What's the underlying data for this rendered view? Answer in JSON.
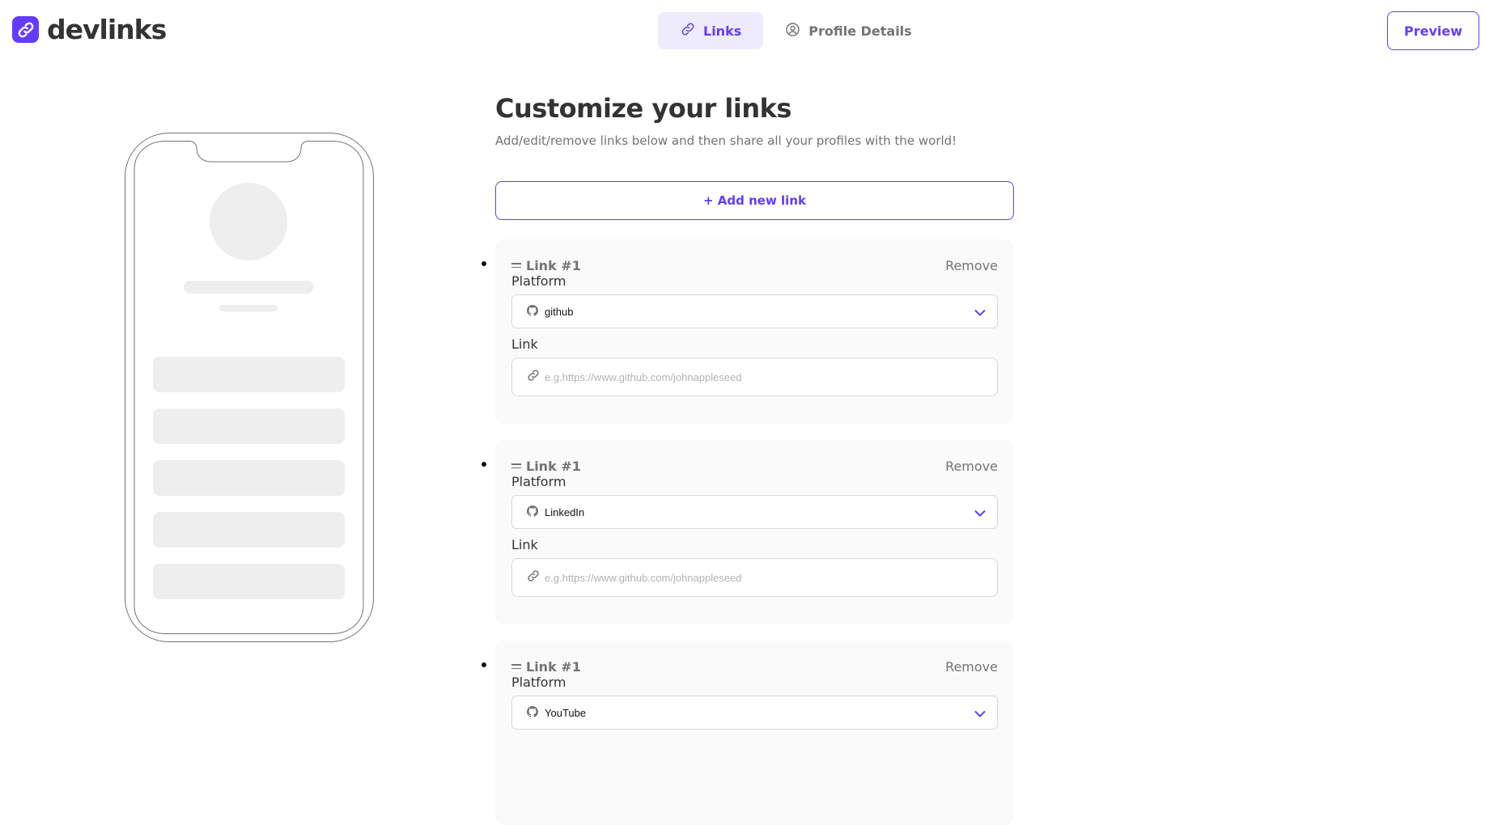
{
  "app": {
    "name": "devlinks",
    "brand_color": "#633cff",
    "logo_icon": "link-logo-icon"
  },
  "nav": {
    "tabs": [
      {
        "label": "Links",
        "icon": "link-icon",
        "active": true
      },
      {
        "label": "Profile Details",
        "icon": "user-circle-icon",
        "active": false
      }
    ],
    "preview_label": "Preview"
  },
  "main": {
    "title": "Customize your links",
    "subtitle": "Add/edit/remove links below and then share all your profiles with the world!",
    "add_label": "+ Add new link",
    "links": [
      {
        "title": "Link #1",
        "remove_label": "Remove",
        "platform_label": "Platform",
        "platform_value": "github",
        "link_label": "Link",
        "link_placeholder": "e.g.https://www.github.com/johnappleseed"
      },
      {
        "title": "Link #1",
        "remove_label": "Remove",
        "platform_label": "Platform",
        "platform_value": "LinkedIn",
        "link_label": "Link",
        "link_placeholder": "e.g.https://www.github.com/johnappleseed"
      },
      {
        "title": "Link #1",
        "remove_label": "Remove",
        "platform_label": "Platform",
        "platform_value": "YouTube"
      }
    ]
  }
}
